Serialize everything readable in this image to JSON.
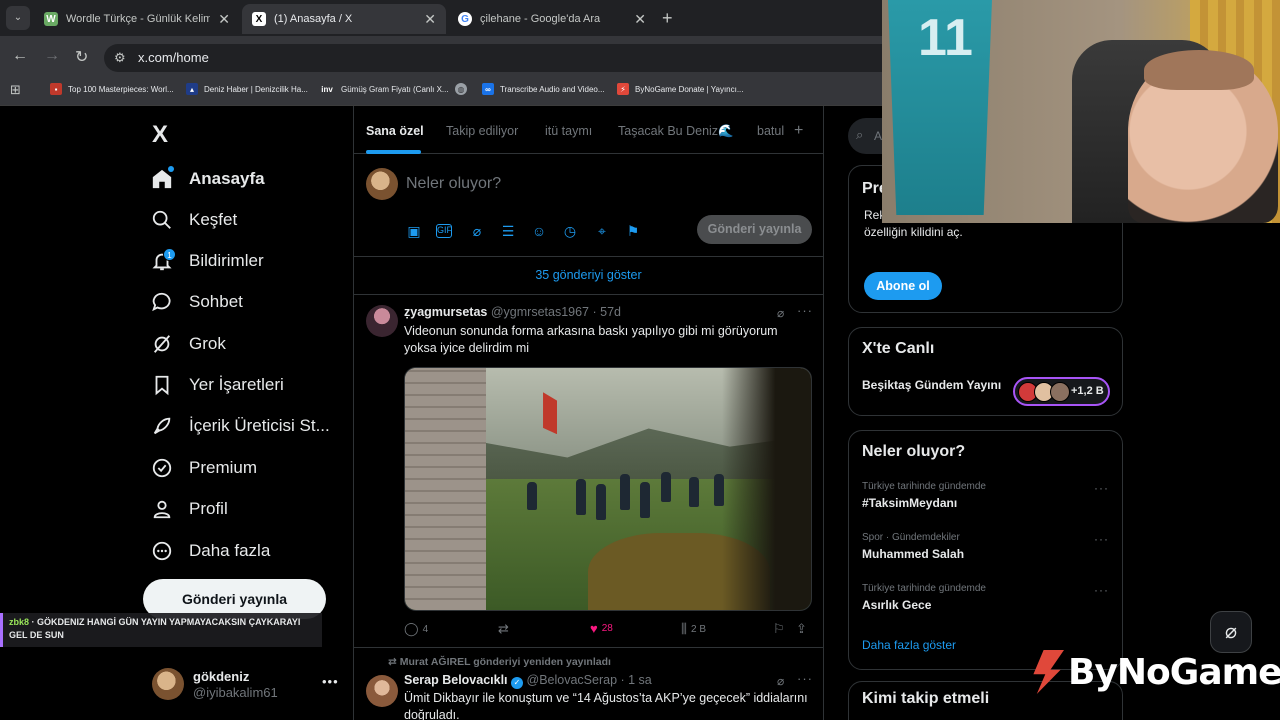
{
  "browser": {
    "tabs": [
      {
        "title": "Wordle Türkçe - Günlük Kelime Oyunu",
        "icon": "W",
        "icon_color": "#6aaa64"
      },
      {
        "title": "(1) Anasayfa / X",
        "icon": "X",
        "icon_color": "#000000"
      },
      {
        "title": "çilehane - Google'da Ara",
        "icon": "G",
        "icon_color": "#4285f4"
      }
    ],
    "url": "x.com/home",
    "bookmarks": [
      {
        "label": "Top 100 Masterpieces: Worl..."
      },
      {
        "label": "Deniz Haber | Denizcilik Ha..."
      },
      {
        "label": "Gümüş Gram Fiyatı (Canlı X...",
        "icon": "inv"
      },
      {
        "label": ""
      },
      {
        "label": "Transcribe Audio and Video..."
      },
      {
        "label": "ByNoGame Donate | Yayıncı..."
      }
    ]
  },
  "nav": {
    "logo": "X",
    "items": [
      {
        "label": "Anasayfa",
        "icon": "home-icon"
      },
      {
        "label": "Keşfet",
        "icon": "search-icon"
      },
      {
        "label": "Bildirimler",
        "icon": "bell-icon"
      },
      {
        "label": "Sohbet",
        "icon": "chat-icon"
      },
      {
        "label": "Grok",
        "icon": "grok-icon"
      },
      {
        "label": "Yer İşaretleri",
        "icon": "bookmark-icon"
      },
      {
        "label": "İçerik Üreticisi St...",
        "icon": "rocket-icon"
      },
      {
        "label": "Premium",
        "icon": "verified-icon"
      },
      {
        "label": "Profil",
        "icon": "person-icon"
      },
      {
        "label": "Daha fazla",
        "icon": "more-circle-icon"
      }
    ],
    "notification_count": "1",
    "post_button": "Gönderi yayınla",
    "account": {
      "name": "gökdeniz",
      "handle": "@iyibakalim61"
    }
  },
  "chat_overlay": {
    "user": "zbk8",
    "message": " · GÖKDENIZ HANGİ GÜN YAYIN YAPMAYACAKSIN ÇAYKARAYI GEL DE SUN"
  },
  "feed": {
    "tabs": [
      "Sana özel",
      "Takip ediliyor",
      "itü taymı",
      "Taşacak Bu Deniz🌊",
      "batul"
    ],
    "compose_placeholder": "Neler oluyor?",
    "compose_post": "Gönderi yayınla",
    "show_new": "35 gönderiyi göster",
    "tweet1": {
      "name": "ẓyagmursetas",
      "handle": "@ygmrsetas1967",
      "time": "· 57d",
      "text": "Videonun sonunda forma arkasına baskı yapılıyo gibi mi görüyorum yoksa iyice delirdim mi",
      "replies": "4",
      "retweets": "",
      "likes": "28",
      "views": "2 B"
    },
    "tweet2": {
      "retweet_by": "Murat AĞIREL gönderiyi yeniden yayınladı",
      "name": "Serap Belovacıklı",
      "handle": "@BelovacSerap",
      "time": "· 1 sa",
      "text": "Ümit Dikbayır ile konuştum ve “14 Ağustos’ta AKP’ye geçecek” iddialarını doğruladı."
    }
  },
  "right": {
    "search_placeholder": "A",
    "premium": {
      "title": "Pre",
      "text": "Rek yanıtlarını öne çıkar ve 20’den fazla özelliğin kilidini aç.",
      "button": "Abone ol"
    },
    "live": {
      "title": "X'te Canlı",
      "item": "Beşiktaş Gündem Yayını",
      "count": "+1,2 B"
    },
    "trends": {
      "title": "Neler oluyor?",
      "items": [
        {
          "category": "Türkiye tarihinde gündemde",
          "name": "#TaksimMeydanı"
        },
        {
          "category": "Spor · Gündemdekiler",
          "name": "Muhammed Salah"
        },
        {
          "category": "Türkiye tarihinde gündemde",
          "name": "Asırlık Gece"
        }
      ],
      "show_more": "Daha fazla göster"
    },
    "who_to_follow": "Kimi takip etmeli"
  },
  "webcam": {
    "jersey_number": "11"
  },
  "watermark": "ByNoGame",
  "colors": {
    "accent": "#1d9bf0",
    "like": "#f91880",
    "background": "#000000"
  }
}
